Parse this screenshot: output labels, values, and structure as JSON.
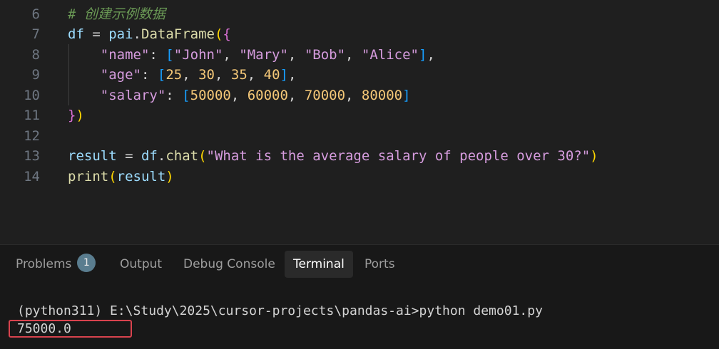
{
  "editor": {
    "lines": [
      {
        "num": "6",
        "tokens": [
          {
            "t": "# 创建示例数据",
            "c": "c-comment"
          }
        ]
      },
      {
        "num": "7",
        "tokens": [
          {
            "t": "df",
            "c": "c-var"
          },
          {
            "t": " = ",
            "c": "c-plain"
          },
          {
            "t": "pai",
            "c": "c-var"
          },
          {
            "t": ".",
            "c": "c-plain"
          },
          {
            "t": "DataFrame",
            "c": "c-fn"
          },
          {
            "t": "(",
            "c": "c-br1"
          },
          {
            "t": "{",
            "c": "c-br2"
          }
        ]
      },
      {
        "num": "8",
        "tokens": [
          {
            "t": "    ",
            "c": "c-plain"
          },
          {
            "t": "\"name\"",
            "c": "c-strm"
          },
          {
            "t": ": ",
            "c": "c-plain"
          },
          {
            "t": "[",
            "c": "c-br3"
          },
          {
            "t": "\"John\"",
            "c": "c-strm"
          },
          {
            "t": ", ",
            "c": "c-plain"
          },
          {
            "t": "\"Mary\"",
            "c": "c-strm"
          },
          {
            "t": ", ",
            "c": "c-plain"
          },
          {
            "t": "\"Bob\"",
            "c": "c-strm"
          },
          {
            "t": ", ",
            "c": "c-plain"
          },
          {
            "t": "\"Alice\"",
            "c": "c-strm"
          },
          {
            "t": "]",
            "c": "c-br3"
          },
          {
            "t": ",",
            "c": "c-plain"
          }
        ]
      },
      {
        "num": "9",
        "tokens": [
          {
            "t": "    ",
            "c": "c-plain"
          },
          {
            "t": "\"age\"",
            "c": "c-strm"
          },
          {
            "t": ": ",
            "c": "c-plain"
          },
          {
            "t": "[",
            "c": "c-br3"
          },
          {
            "t": "25",
            "c": "c-num"
          },
          {
            "t": ", ",
            "c": "c-plain"
          },
          {
            "t": "30",
            "c": "c-num"
          },
          {
            "t": ", ",
            "c": "c-plain"
          },
          {
            "t": "35",
            "c": "c-num"
          },
          {
            "t": ", ",
            "c": "c-plain"
          },
          {
            "t": "40",
            "c": "c-num"
          },
          {
            "t": "]",
            "c": "c-br3"
          },
          {
            "t": ",",
            "c": "c-plain"
          }
        ]
      },
      {
        "num": "10",
        "tokens": [
          {
            "t": "    ",
            "c": "c-plain"
          },
          {
            "t": "\"salary\"",
            "c": "c-strm"
          },
          {
            "t": ": ",
            "c": "c-plain"
          },
          {
            "t": "[",
            "c": "c-br3"
          },
          {
            "t": "50000",
            "c": "c-num"
          },
          {
            "t": ", ",
            "c": "c-plain"
          },
          {
            "t": "60000",
            "c": "c-num"
          },
          {
            "t": ", ",
            "c": "c-plain"
          },
          {
            "t": "70000",
            "c": "c-num"
          },
          {
            "t": ", ",
            "c": "c-plain"
          },
          {
            "t": "80000",
            "c": "c-num"
          },
          {
            "t": "]",
            "c": "c-br3"
          }
        ]
      },
      {
        "num": "11",
        "tokens": [
          {
            "t": "}",
            "c": "c-br2"
          },
          {
            "t": ")",
            "c": "c-br1"
          }
        ]
      },
      {
        "num": "12",
        "tokens": []
      },
      {
        "num": "13",
        "tokens": [
          {
            "t": "result",
            "c": "c-var"
          },
          {
            "t": " = ",
            "c": "c-plain"
          },
          {
            "t": "df",
            "c": "c-var"
          },
          {
            "t": ".",
            "c": "c-plain"
          },
          {
            "t": "chat",
            "c": "c-fn"
          },
          {
            "t": "(",
            "c": "c-br1"
          },
          {
            "t": "\"What is the average salary of people over 30?\"",
            "c": "c-strm"
          },
          {
            "t": ")",
            "c": "c-br1"
          }
        ]
      },
      {
        "num": "14",
        "tokens": [
          {
            "t": "print",
            "c": "c-builtin"
          },
          {
            "t": "(",
            "c": "c-br1"
          },
          {
            "t": "result",
            "c": "c-var"
          },
          {
            "t": ")",
            "c": "c-br1"
          }
        ]
      }
    ]
  },
  "panel": {
    "tabs": [
      {
        "label": "Problems",
        "badge": "1"
      },
      {
        "label": "Output"
      },
      {
        "label": "Debug Console"
      },
      {
        "label": "Terminal",
        "active": true
      },
      {
        "label": "Ports"
      }
    ]
  },
  "terminal": {
    "command_line": "(python311) E:\\Study\\2025\\cursor-projects\\pandas-ai>python demo01.py",
    "output": "75000.0"
  }
}
